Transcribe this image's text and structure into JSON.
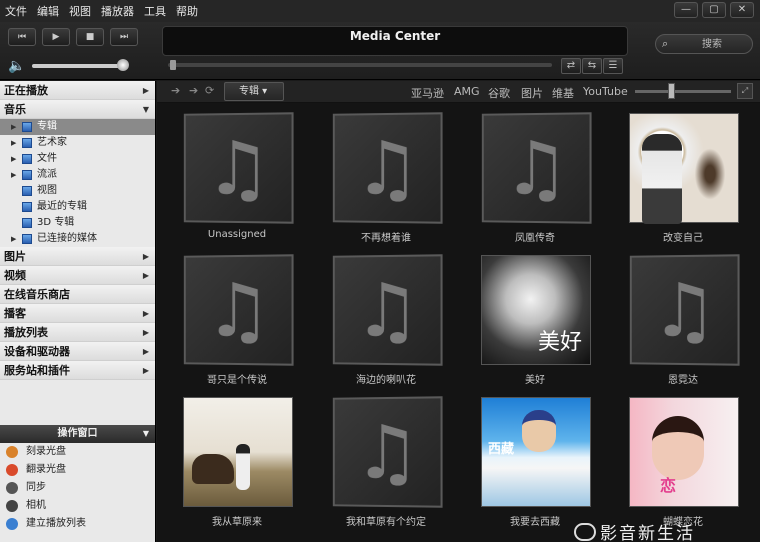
{
  "menu": [
    "文件",
    "编辑",
    "视图",
    "播放器",
    "工具",
    "帮助"
  ],
  "window_buttons": [
    "—",
    "▢",
    "✕"
  ],
  "transport": {
    "prev": "⏮",
    "play": "▶",
    "stop": "■",
    "next": "⏭"
  },
  "now_playing": {
    "title": "Media Center"
  },
  "volume": {
    "level": 0.95
  },
  "search": {
    "placeholder": "搜索"
  },
  "sidebar": {
    "sections": [
      {
        "label": "正在播放"
      },
      {
        "label": "音乐",
        "expanded": true
      }
    ],
    "music_items": [
      {
        "label": "专辑",
        "selected": true,
        "expandable": true
      },
      {
        "label": "艺术家",
        "expandable": true
      },
      {
        "label": "文件",
        "expandable": true
      },
      {
        "label": "流派",
        "expandable": true
      },
      {
        "label": "视图",
        "expandable": false
      },
      {
        "label": "最近的专辑",
        "expandable": false
      },
      {
        "label": "3D 专辑",
        "expandable": false
      },
      {
        "label": "已连接的媒体",
        "expandable": true
      }
    ],
    "more_sections": [
      {
        "label": "图片"
      },
      {
        "label": "视频"
      },
      {
        "label": "在线音乐商店"
      },
      {
        "label": "播客"
      },
      {
        "label": "播放列表"
      },
      {
        "label": "设备和驱动器"
      },
      {
        "label": "服务站和插件"
      }
    ]
  },
  "actions": {
    "title": "操作窗口",
    "items": [
      {
        "label": "刻录光盘",
        "color": "#d9822b"
      },
      {
        "label": "翻录光盘",
        "color": "#d94a2b"
      },
      {
        "label": "同步",
        "color": "#555555"
      },
      {
        "label": "相机",
        "color": "#444444"
      },
      {
        "label": "建立播放列表",
        "color": "#3a7fd1"
      }
    ]
  },
  "browser": {
    "view": "专辑",
    "sources": [
      "亚马逊",
      "AMG",
      "谷歌",
      "图片",
      "维基",
      "YouTube"
    ],
    "zoom_level": 0.38
  },
  "albums": [
    {
      "title": "Unassigned",
      "art": "placeholder"
    },
    {
      "title": "不再想着谁",
      "art": "placeholder"
    },
    {
      "title": "凤凰传奇",
      "art": "placeholder"
    },
    {
      "title": "改变自己",
      "art": "photo-a1"
    },
    {
      "title": "哥只是个传说",
      "art": "placeholder"
    },
    {
      "title": "海边的喇叭花",
      "art": "placeholder"
    },
    {
      "title": "美好",
      "art": "photo-a2"
    },
    {
      "title": "恩霓达",
      "art": "placeholder"
    },
    {
      "title": "我从草原来",
      "art": "photo-a3"
    },
    {
      "title": "我和草原有个约定",
      "art": "placeholder"
    },
    {
      "title": "我要去西藏",
      "art": "photo-a4"
    },
    {
      "title": "蝴蝶恋花",
      "art": "photo-a5"
    }
  ],
  "art_text": {
    "a2": "美好",
    "a4": "西藏",
    "a5": "恋"
  },
  "watermark": "影音新生活"
}
